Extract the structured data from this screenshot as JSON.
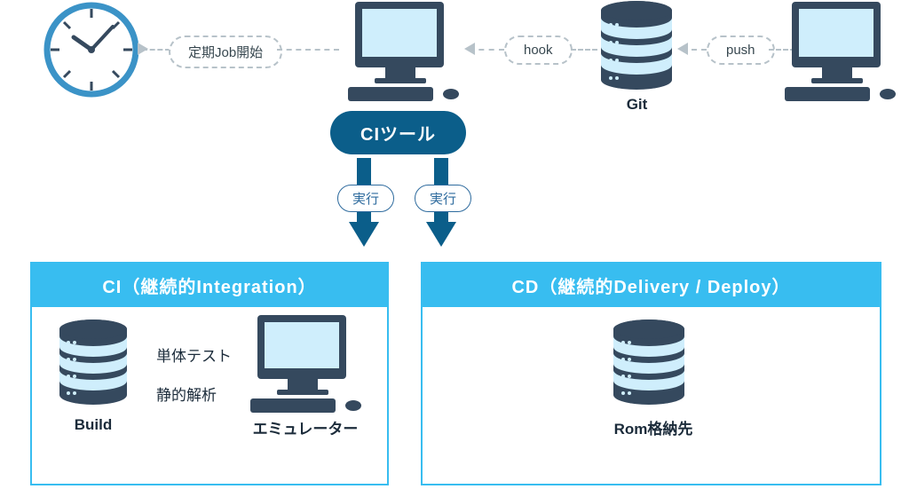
{
  "connectors": {
    "scheduled_job": "定期Job開始",
    "hook": "hook",
    "push": "push",
    "run_left": "実行",
    "run_right": "実行"
  },
  "nodes": {
    "ci_tool": "CIツール",
    "git": "Git",
    "build": "Build",
    "unit_test": "単体テスト",
    "static_analysis": "静的解析",
    "emulator": "エミュレーター",
    "rom_target": "Rom格納先"
  },
  "panels": {
    "ci_title": "CI（継続的Integration）",
    "cd_title": "CD（継続的Delivery / Deploy）"
  },
  "colors": {
    "accent_cyan": "#38bdf0",
    "accent_navy": "#0b5e8a",
    "stroke_dark": "#35495e",
    "screen_fill": "#cfeefc"
  }
}
